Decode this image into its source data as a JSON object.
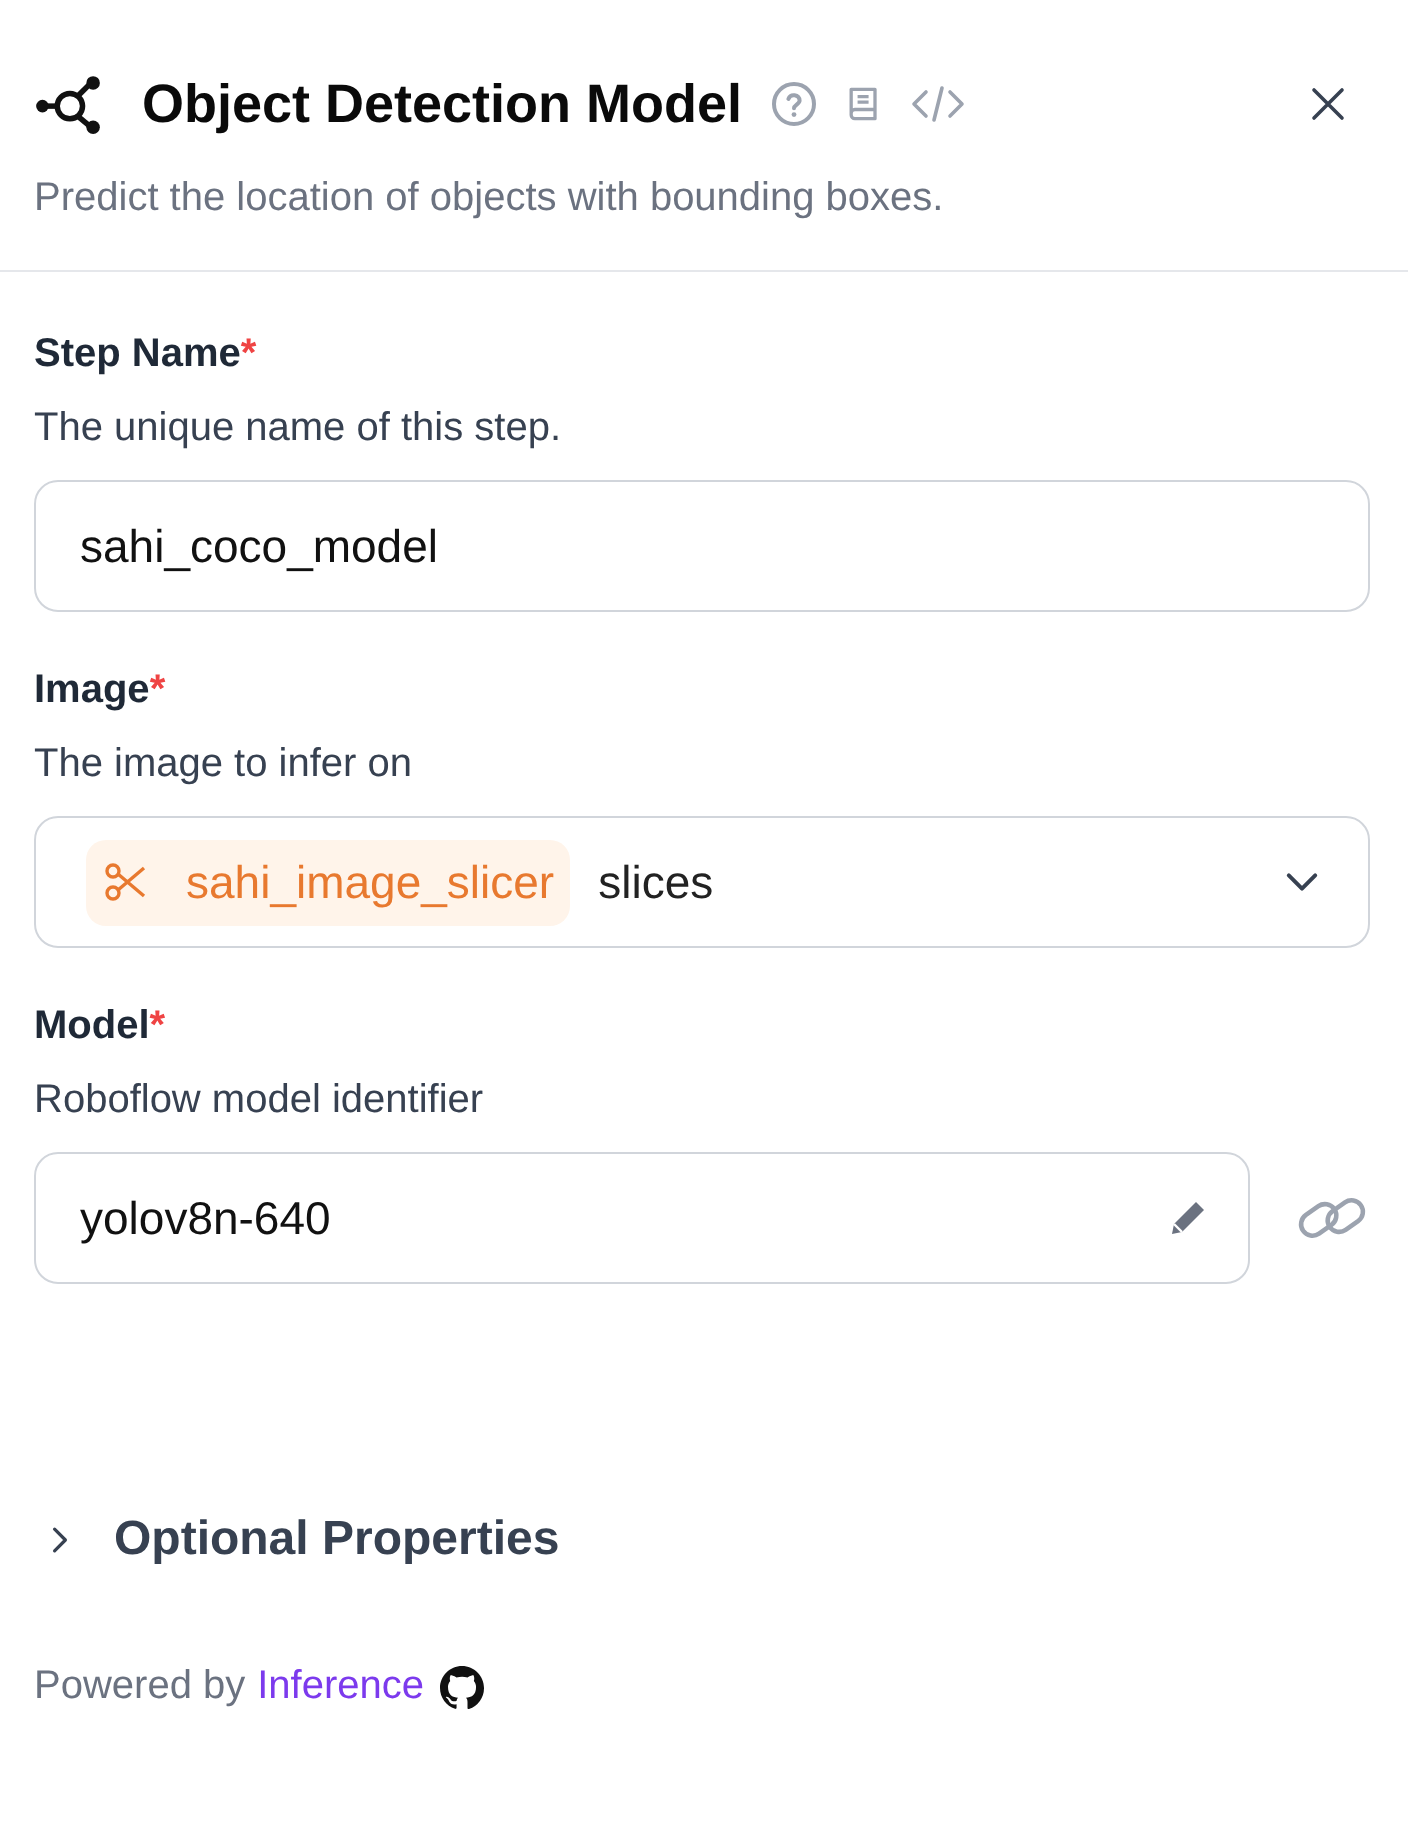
{
  "header": {
    "title": "Object Detection Model",
    "description": "Predict the location of objects with bounding boxes."
  },
  "fields": [
    {
      "kind": "text",
      "label": "Step Name",
      "required_mark": "*",
      "description": "The unique name of this step.",
      "value": "sahi_coco_model"
    },
    {
      "kind": "select",
      "label": "Image",
      "required_mark": "*",
      "description": "The image to infer on",
      "chip": "sahi_image_slicer",
      "value": "slices"
    },
    {
      "kind": "model",
      "label": "Model",
      "required_mark": "*",
      "description": "Roboflow model identifier",
      "value": "yolov8n-640"
    }
  ],
  "optional": {
    "label": "Optional Properties",
    "expanded": false
  },
  "footer": {
    "text": "Powered by",
    "link": "Inference"
  }
}
